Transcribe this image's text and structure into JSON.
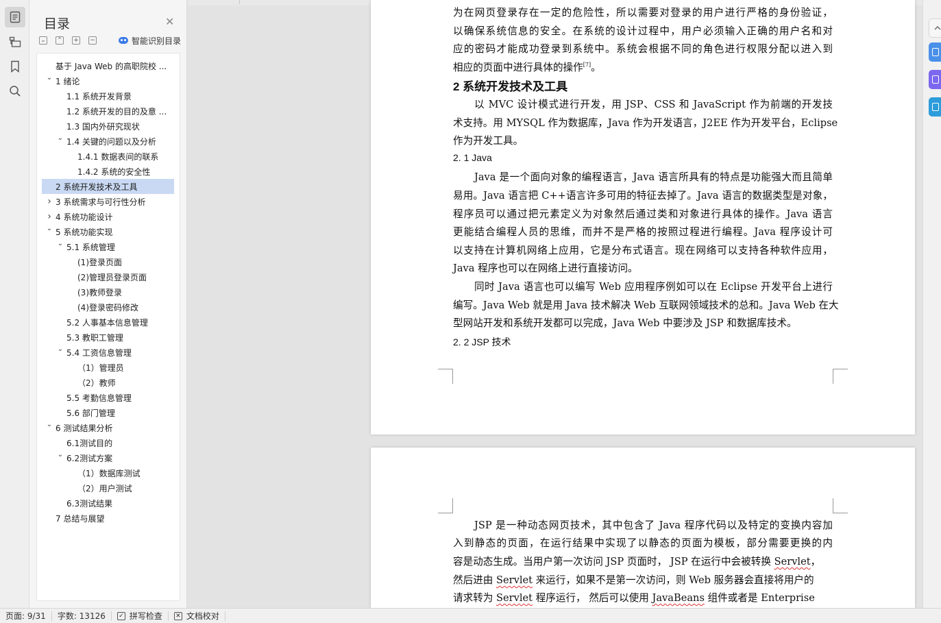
{
  "toc": {
    "title": "目录",
    "smart_label": "智能识别目录",
    "items": [
      {
        "label": "基于 Java Web 的高职院校 ...",
        "level": 0,
        "arrow": "",
        "selected": false
      },
      {
        "label": "1  绪论",
        "level": 0,
        "arrow": "v",
        "selected": false
      },
      {
        "label": "1.1 系统开发背景",
        "level": 1,
        "arrow": "",
        "selected": false
      },
      {
        "label": "1.2 系统开发的目的及意 ...",
        "level": 1,
        "arrow": "",
        "selected": false
      },
      {
        "label": "1.3 国内外研究现状",
        "level": 1,
        "arrow": "",
        "selected": false
      },
      {
        "label": "1.4 关键的问题以及分析",
        "level": 1,
        "arrow": "v",
        "selected": false
      },
      {
        "label": "1.4.1 数据表间的联系",
        "level": 2,
        "arrow": "",
        "selected": false
      },
      {
        "label": "1.4.2 系统的安全性",
        "level": 2,
        "arrow": "",
        "selected": false
      },
      {
        "label": "2  系统开发技术及工具",
        "level": 0,
        "arrow": "",
        "selected": true
      },
      {
        "label": "3  系统需求与可行性分析",
        "level": 0,
        "arrow": ">",
        "selected": false
      },
      {
        "label": "4  系统功能设计",
        "level": 0,
        "arrow": ">",
        "selected": false
      },
      {
        "label": "5  系统功能实现",
        "level": 0,
        "arrow": "v",
        "selected": false
      },
      {
        "label": "5.1 系统管理",
        "level": 1,
        "arrow": "v",
        "selected": false
      },
      {
        "label": "(1)登录页面",
        "level": 2,
        "arrow": "",
        "selected": false
      },
      {
        "label": "(2)管理员登录页面",
        "level": 2,
        "arrow": "",
        "selected": false
      },
      {
        "label": "(3)教师登录",
        "level": 2,
        "arrow": "",
        "selected": false
      },
      {
        "label": "(4)登录密码修改",
        "level": 2,
        "arrow": "",
        "selected": false
      },
      {
        "label": "5.2 人事基本信息管理",
        "level": 1,
        "arrow": "",
        "selected": false
      },
      {
        "label": "5.3 教职工管理",
        "level": 1,
        "arrow": "",
        "selected": false
      },
      {
        "label": "5.4 工资信息管理",
        "level": 1,
        "arrow": "v",
        "selected": false
      },
      {
        "label": "（1）管理员",
        "level": 2,
        "arrow": "",
        "selected": false
      },
      {
        "label": "（2）教师",
        "level": 2,
        "arrow": "",
        "selected": false
      },
      {
        "label": "5.5 考勤信息管理",
        "level": 1,
        "arrow": "",
        "selected": false
      },
      {
        "label": "5.6 部门管理",
        "level": 1,
        "arrow": "",
        "selected": false
      },
      {
        "label": "6  测试结果分析",
        "level": 0,
        "arrow": "v",
        "selected": false
      },
      {
        "label": "6.1测试目的",
        "level": 1,
        "arrow": "",
        "selected": false
      },
      {
        "label": "6.2测试方案",
        "level": 1,
        "arrow": "v",
        "selected": false
      },
      {
        "label": "（1）数据库测试",
        "level": 2,
        "arrow": "",
        "selected": false
      },
      {
        "label": "（2）用户测试",
        "level": 2,
        "arrow": "",
        "selected": false
      },
      {
        "label": "6.3测试结果",
        "level": 1,
        "arrow": "",
        "selected": false
      },
      {
        "label": "7  总结与展望",
        "level": 0,
        "arrow": "",
        "selected": false
      }
    ]
  },
  "document": {
    "page1": {
      "intro_lines": [
        "为在网页登录存在一定的危险性，所以需要对登录的用户进行严格的身份验证，",
        "以确保系统信息的安全。在系统的设计过程中，用户必须输入正确的用户名和对",
        "应的密码才能成功登录到系统中。系统会根据不同的角色进行权限分配以进入到"
      ],
      "intro_last": "相应的页面中进行具体的操作",
      "citation": "[7]",
      "intro_end": "。",
      "heading": "2  系统开发技术及工具",
      "p1_lines": [
        "以 MVC 设计模式进行开发，用 JSP、CSS 和 JavaScript 作为前端的开发技",
        "术支持。用 MYSQL 作为数据库，Java 作为开发语言，J2EE 作为开发平台，Eclipse",
        "作为开发工具。"
      ],
      "sub1": "2. 1  Java",
      "p2_lines": [
        "Java 是一个面向对象的编程语言，Java 语言所具有的特点是功能强大而且简单",
        "易用。Java 语言把 C++语言许多可用的特征去掉了。Java 语言的数据类型是对象，",
        "程序员可以通过把元素定义为对象然后通过类和对象进行具体的操作。Java 语言",
        "更能结合编程人员的思维，而并不是严格的按照过程进行编程。Java 程序设计可",
        "以支持在计算机网络上应用，它是分布式语言。现在网络可以支持各种软件应用，",
        "Java 程序也可以在网络上进行直接访问。"
      ],
      "p3_lines": [
        "同时 Java 语言也可以编写 Web 应用程序例如可以在 Eclipse 开发平台上进行",
        "编写。Java Web 就是用 Java 技术解决 Web 互联网领域技术的总和。Java Web 在大",
        "型网站开发和系统开发都可以完成，Java Web 中要涉及 JSP 和数据库技术。"
      ],
      "sub2": "2. 2  JSP 技术"
    },
    "page2": {
      "l1": "JSP 是一种动态网页技术，其中包含了 Java 程序代码以及特定的变换内容加",
      "l2": "入到静态的页面，在运行结果中实现了以静态的页面为模板，部分需要更换的内",
      "l3_a": "容是动态生成。当用户第一次访问  JSP 页面时，  JSP 在运行中会被转换  ",
      "l3_b": "Servlet",
      "l3_c": "，",
      "l4_a": "然后进由 ",
      "l4_b": "Servlet",
      "l4_c": " 来运行，如果不是第一次访问，则  Web 服务器会直接将用户的",
      "l5_a": "请求转为  ",
      "l5_b": "Servlet",
      "l5_c": " 程序运行，  然后可以使用   ",
      "l5_d": "JavaBeans",
      "l5_e": " 组件或者是   Enterprise"
    }
  },
  "status": {
    "page": "页面: 9/31",
    "words": "字数: 13126",
    "spell": "拼写检查",
    "proof": "文档校对"
  },
  "colors": {
    "accent": "#3b7be8",
    "toc_selected": "#c9d9f3",
    "right_btn_1": "#4a90e8",
    "right_btn_2": "#7b68ee",
    "right_btn_3": "#2d9cdb"
  },
  "icons": {
    "rail": [
      "document-icon",
      "folder-icon",
      "bookmark-icon",
      "search-icon"
    ]
  }
}
